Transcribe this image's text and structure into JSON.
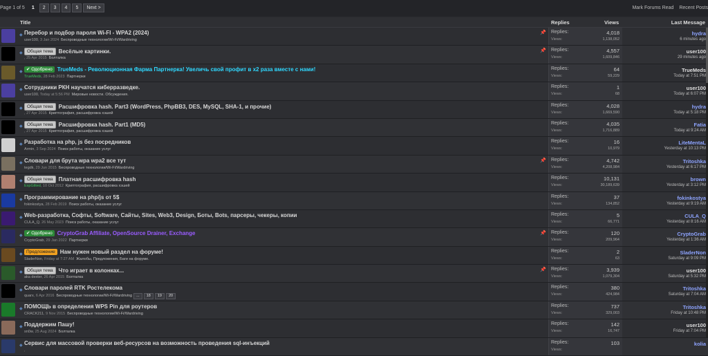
{
  "pagination": {
    "label": "Page 1 of 5",
    "pages": [
      "1",
      "2",
      "3",
      "4",
      "5"
    ],
    "next": "Next >"
  },
  "toplinks": {
    "mark_read": "Mark Forums Read",
    "recent": "Recent Posts"
  },
  "columns": {
    "title": "Title",
    "replies": "Replies",
    "views": "Views",
    "last": "Last Message"
  },
  "labels": {
    "replies": "Replies:",
    "views": "Views:"
  },
  "threads": [
    {
      "prefix": "",
      "title": "Перебор и подбор пароля Wi-FI - WPA2 (2024)",
      "title_color": "",
      "author": "user100",
      "date": "3 Jan 2024",
      "forum": "Беспроводные технологии/Wi-Fi/Wardriving",
      "pinned": true,
      "replies": "4,018",
      "views": "1,138,052",
      "last_user": "hydra",
      "last_time": "6 minutes ago",
      "last_color": "blue",
      "avatar": "#4b3fa0"
    },
    {
      "prefix": "Общая тема",
      "prefix_color": "gray",
      "title": "Весёлые картинки.",
      "title_color": "",
      "author": "",
      "date": "25 Apr 2015",
      "forum": "Болталка",
      "pinned": true,
      "replies": "4,557",
      "views": "1,609,846",
      "last_user": "user100",
      "last_time": "29 minutes ago",
      "last_color": "",
      "avatar": "#000000"
    },
    {
      "prefix": "Одобрено",
      "prefix_color": "green",
      "title": "TrueMeds - Революционная Фарма Партнерка! Увеличь свой профит в x2 раза вместе с нами!",
      "title_color": "cyan",
      "author": "TrueMeds",
      "author_color": "green",
      "date": "28 Feb 2023",
      "forum": "Партнерки",
      "pinned": false,
      "replies": "64",
      "views": "59,229",
      "last_user": "TrueMeds",
      "last_time": "Today at 7:51 PM",
      "last_color": "",
      "avatar": "#6a5a2a"
    },
    {
      "prefix": "",
      "title": "Сотрудники РКН научатся киберразведке.",
      "title_color": "",
      "author": "user100",
      "date": "Today at 5:56 PM",
      "forum": "Мировые новости. Обсуждения.",
      "pinned": false,
      "replies": "1",
      "views": "68",
      "last_user": "user100",
      "last_time": "Today at 6:07 PM",
      "last_color": "",
      "avatar": "#4b3fa0"
    },
    {
      "prefix": "Общая тема",
      "prefix_color": "gray",
      "title": "Расшифровка hash. Part3 (WordPress, PhpBB3, DES, MySQL, SHA-1, и прочие)",
      "title_color": "",
      "author": "",
      "date": "27 Apr 2015",
      "forum": "Криптография, расшифровка хэшей",
      "pinned": false,
      "replies": "4,028",
      "views": "1,669,590",
      "last_user": "hydra",
      "last_time": "Today at 5:18 PM",
      "last_color": "blue",
      "avatar": "#000000"
    },
    {
      "prefix": "Общая тема",
      "prefix_color": "gray",
      "title": "Расшифровка hash. Part1 (MD5)",
      "title_color": "",
      "author": "",
      "date": "27 Apr 2015",
      "forum": "Криптография, расшифровка хэшей",
      "pinned": false,
      "replies": "4,035",
      "views": "1,716,889",
      "last_user": "Fatia",
      "last_time": "Today at 9:24 AM",
      "last_color": "blue",
      "avatar": "#000000"
    },
    {
      "prefix": "",
      "title": "Разработка на php, js без посредников",
      "title_color": "",
      "author": "Armin",
      "date": "3 Sep 2024",
      "forum": "Поиск работы, оказание услуг",
      "pinned": false,
      "replies": "16",
      "views": "10,979",
      "last_user": "LiteMentaL",
      "last_time": "Yesterday at 10:13 PM",
      "last_color": "blue",
      "avatar": "#d0d0d0"
    },
    {
      "prefix": "",
      "title": "Словари для брута wpa wpa2 все тут",
      "title_color": "",
      "author": "tegdk",
      "date": "29 Jun 2015",
      "forum": "Беспроводные технологии/Wi-Fi/Wardriving",
      "pinned": true,
      "replies": "4,742",
      "views": "4,208,984",
      "last_user": "Tritoshka",
      "last_time": "Yesterday at 6:17 PM",
      "last_color": "blue",
      "avatar": "#7a7060"
    },
    {
      "prefix": "Общая тема",
      "prefix_color": "gray",
      "title": "Платная расшифровка hash",
      "title_color": "",
      "author": "ExpGlited",
      "author_color": "green",
      "date": "10 Oct 2012",
      "forum": "Криптография, расшифровка хэшей",
      "pinned": false,
      "replies": "10,131",
      "views": "30,189,639",
      "last_user": "brown",
      "last_time": "Yesterday at 3:12 PM",
      "last_color": "blue",
      "avatar": "#b08070"
    },
    {
      "prefix": "",
      "title": "Программирование на php/js от 5$",
      "title_color": "",
      "author": "fokinkostya",
      "date": "28 Feb 2019",
      "forum": "Поиск работы, оказание услуг",
      "pinned": false,
      "replies": "37",
      "views": "134,852",
      "last_user": "fokinkostya",
      "last_time": "Yesterday at 9:19 AM",
      "last_color": "blue",
      "avatar": "#1a3aa0"
    },
    {
      "prefix": "",
      "title": "Web-разработка, Софты, Software, Сайты, Sites, Web3, Design, Боты, Bots, парсеры, чекеры, копии",
      "title_color": "",
      "author": "CULA_Q",
      "date": "26 May 2023",
      "forum": "Поиск работы, оказание услуг",
      "pinned": false,
      "replies": "5",
      "views": "66,771",
      "last_user": "CULA_Q",
      "last_time": "Yesterday at 8:16 AM",
      "last_color": "blue",
      "avatar": "#3a1a70"
    },
    {
      "prefix": "Одобрено",
      "prefix_color": "green",
      "title": "CryptoGrab Affiliate, OpenSource Drainer, Exchange",
      "title_color": "purple",
      "author": "CryptoGrab",
      "date": "29 Jan 2022",
      "forum": "Партнерки",
      "pinned": true,
      "replies": "120",
      "views": "209,964",
      "last_user": "CryptoGrab",
      "last_time": "Yesterday at 1:36 AM",
      "last_color": "blue",
      "avatar": "#2a2a60"
    },
    {
      "prefix": "Предложение",
      "prefix_color": "orange",
      "title": "Нам нужен новый раздел на форуме!",
      "title_color": "",
      "author": "SladerNon",
      "date": "Friday at 7:27 AM",
      "forum": "Жалобы, Предложения, Баги на форуме.",
      "pinned": false,
      "replies": "2",
      "views": "63",
      "last_user": "SladerNon",
      "last_time": "Saturday at 9:09 PM",
      "last_color": "blue",
      "avatar": "#6a4a20"
    },
    {
      "prefix": "Общая тема",
      "prefix_color": "gray",
      "title": "Что играет в колонках...",
      "title_color": "",
      "author": "aka dexter",
      "date": "26 Apr 2015",
      "forum": "Болталка",
      "pinned": true,
      "replies": "3,939",
      "views": "1,079,304",
      "last_user": "user100",
      "last_time": "Saturday at 5:32 PM",
      "last_color": "",
      "avatar": "#2a5a2a"
    },
    {
      "prefix": "",
      "title": "Словари паролей RTK Ростелекома",
      "title_color": "",
      "author": "quarx",
      "date": "6 Apr 2016",
      "forum": "Беспроводные технологии/Wi-Fi/Wardriving",
      "pages": [
        "...",
        "18",
        "19",
        "20"
      ],
      "pinned": false,
      "replies": "380",
      "views": "424,984",
      "last_user": "Tritoshka",
      "last_time": "Saturday at 7:04 AM",
      "last_color": "blue",
      "avatar": "#000000"
    },
    {
      "prefix": "",
      "title": "ПОМОЩЬ в определения WPS Pin для роутеров",
      "title_color": "",
      "author": "CRACK211",
      "date": "9 Nov 2015",
      "forum": "Беспроводные технологии/Wi-Fi/Wardriving",
      "pinned": false,
      "replies": "737",
      "views": "329,003",
      "last_user": "Tritoshka",
      "last_time": "Friday at 10:48 PM",
      "last_color": "blue",
      "avatar": "#1a7a2a"
    },
    {
      "prefix": "",
      "title": "Поддержим Пашу!",
      "title_color": "",
      "author": "sn0w",
      "date": "25 Aug 2024",
      "forum": "Болталка",
      "pinned": false,
      "replies": "142",
      "views": "16,747",
      "last_user": "user100",
      "last_time": "Friday at 7:04 PM",
      "last_color": "",
      "avatar": "#8a6a5a"
    },
    {
      "prefix": "",
      "title": "Сервис для массовой проверки веб-ресурсов на возможность проведения sql-инъекций",
      "title_color": "",
      "author": "",
      "date": "",
      "forum": "",
      "pinned": false,
      "replies": "103",
      "views": "",
      "last_user": "kolia",
      "last_time": "",
      "last_color": "blue",
      "avatar": "#2a3a6a"
    }
  ]
}
